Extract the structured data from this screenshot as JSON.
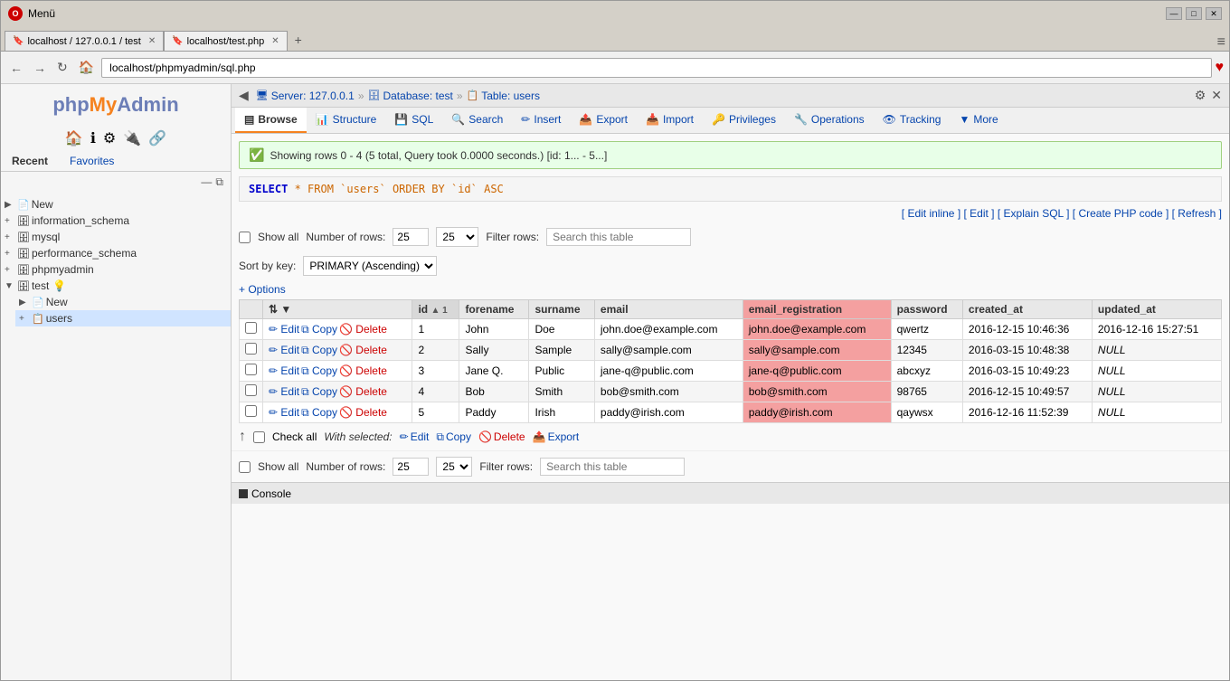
{
  "browser": {
    "title": "Menü",
    "tabs": [
      {
        "label": "localhost / 127.0.0.1 / test",
        "active": false,
        "icon": "🔖"
      },
      {
        "label": "localhost/test.php",
        "active": true,
        "icon": "🔖"
      }
    ],
    "address": "localhost/phpmyadmin/sql.php",
    "new_tab_icon": "+"
  },
  "breadcrumb": {
    "server": "Server: 127.0.0.1",
    "database": "Database: test",
    "table": "Table: users",
    "server_icon": "🖥",
    "db_icon": "🗄",
    "table_icon": "📋"
  },
  "tab_nav": {
    "items": [
      {
        "label": "Browse",
        "icon": "▤",
        "active": true
      },
      {
        "label": "Structure",
        "icon": "📊",
        "active": false
      },
      {
        "label": "SQL",
        "icon": "💾",
        "active": false
      },
      {
        "label": "Search",
        "icon": "🔍",
        "active": false
      },
      {
        "label": "Insert",
        "icon": "✏",
        "active": false
      },
      {
        "label": "Export",
        "icon": "📤",
        "active": false
      },
      {
        "label": "Import",
        "icon": "📥",
        "active": false
      },
      {
        "label": "Privileges",
        "icon": "🔑",
        "active": false
      },
      {
        "label": "Operations",
        "icon": "🔧",
        "active": false
      },
      {
        "label": "Tracking",
        "icon": "👁",
        "active": false
      },
      {
        "label": "More",
        "icon": "▼",
        "active": false
      }
    ]
  },
  "info_banner": {
    "text": "Showing rows 0 - 4 (5 total, Query took 0.0000 seconds.) [id: 1... - 5...]"
  },
  "sql_query": {
    "select": "SELECT",
    "rest": " * FROM `users` ORDER BY `id` ASC"
  },
  "sql_links": {
    "edit_inline": "Edit inline",
    "edit": "Edit",
    "explain_sql": "Explain SQL",
    "create_php": "Create PHP code",
    "refresh": "Refresh"
  },
  "table_controls": {
    "show_all_label": "Show all",
    "num_rows_label": "Number of rows:",
    "num_rows_value": "25",
    "filter_label": "Filter rows:",
    "filter_placeholder": "Search this table"
  },
  "sort_bar": {
    "label": "Sort by key:",
    "value": "PRIMARY (Ascending)"
  },
  "options_link": "+ Options",
  "columns": [
    {
      "key": "checkbox",
      "label": ""
    },
    {
      "key": "actions",
      "label": ""
    },
    {
      "key": "id",
      "label": "id",
      "sort": true
    },
    {
      "key": "forename",
      "label": "forename"
    },
    {
      "key": "surname",
      "label": "surname"
    },
    {
      "key": "email",
      "label": "email"
    },
    {
      "key": "email_registration",
      "label": "email_registration",
      "highlight": true
    },
    {
      "key": "password",
      "label": "password"
    },
    {
      "key": "created_at",
      "label": "created_at"
    },
    {
      "key": "updated_at",
      "label": "updated_at"
    }
  ],
  "rows": [
    {
      "id": "1",
      "forename": "John",
      "surname": "Doe",
      "email": "john.doe@example.com",
      "email_registration": "john.doe@example.com",
      "password": "qwertz",
      "created_at": "2016-12-15 10:46:36",
      "updated_at": "2016-12-16 15:27:51",
      "highlight": true
    },
    {
      "id": "2",
      "forename": "Sally",
      "surname": "Sample",
      "email": "sally@sample.com",
      "email_registration": "sally@sample.com",
      "password": "12345",
      "created_at": "2016-03-15 10:48:38",
      "updated_at": "NULL",
      "highlight": true
    },
    {
      "id": "3",
      "forename": "Jane Q.",
      "surname": "Public",
      "email": "jane-q@public.com",
      "email_registration": "jane-q@public.com",
      "password": "abcxyz",
      "created_at": "2016-03-15 10:49:23",
      "updated_at": "NULL",
      "highlight": true
    },
    {
      "id": "4",
      "forename": "Bob",
      "surname": "Smith",
      "email": "bob@smith.com",
      "email_registration": "bob@smith.com",
      "password": "98765",
      "created_at": "2016-12-15 10:49:57",
      "updated_at": "NULL",
      "highlight": true
    },
    {
      "id": "5",
      "forename": "Paddy",
      "surname": "Irish",
      "email": "paddy@irish.com",
      "email_registration": "paddy@irish.com",
      "password": "qaywsx",
      "created_at": "2016-12-16 11:52:39",
      "updated_at": "NULL",
      "highlight": true
    }
  ],
  "bottom_actions": {
    "up_arrow": "↑",
    "check_all": "Check all",
    "with_selected": "With selected:",
    "edit": "Edit",
    "copy": "Copy",
    "delete": "Delete",
    "export": "Export"
  },
  "sidebar": {
    "logo_php": "php",
    "logo_my": "My",
    "logo_admin": "Admin",
    "tabs": [
      "Recent",
      "Favorites"
    ],
    "tree": [
      {
        "label": "New",
        "level": 0,
        "expanded": false,
        "icon": "📄"
      },
      {
        "label": "information_schema",
        "level": 0,
        "expanded": false,
        "icon": "🗄"
      },
      {
        "label": "mysql",
        "level": 0,
        "expanded": false,
        "icon": "🗄"
      },
      {
        "label": "performance_schema",
        "level": 0,
        "expanded": false,
        "icon": "🗄"
      },
      {
        "label": "phpmyadmin",
        "level": 0,
        "expanded": false,
        "icon": "🗄"
      },
      {
        "label": "test",
        "level": 0,
        "expanded": true,
        "icon": "🗄",
        "badge": "💡"
      },
      {
        "label": "New",
        "level": 1,
        "expanded": false,
        "icon": "📄"
      },
      {
        "label": "users",
        "level": 1,
        "expanded": true,
        "icon": "📋"
      }
    ]
  },
  "console": {
    "label": "Console"
  }
}
